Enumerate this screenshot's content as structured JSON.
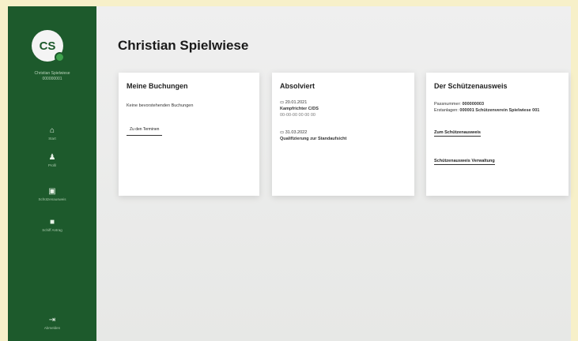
{
  "sidebar": {
    "avatar_initials": "CS",
    "user_name": "Christian Spielwiese\n000000001",
    "items": [
      {
        "label": "Start",
        "icon": "home-icon"
      },
      {
        "label": "Profil",
        "icon": "user-icon"
      },
      {
        "label": "Schützenausweis",
        "icon": "id-card-icon"
      },
      {
        "label": "Schiff Antrag",
        "icon": "document-icon"
      }
    ],
    "logout_label": "Abmelden",
    "logout_icon": "logout-icon"
  },
  "page": {
    "title": "Christian Spielwiese"
  },
  "cards": {
    "bookings": {
      "title": "Meine Buchungen",
      "empty_text": "Keine bevorstehenden Buchungen",
      "button_label": "Zu den Terminen"
    },
    "completed": {
      "title": "Absolviert",
      "entries": [
        {
          "date": "20.01.2021",
          "name": "Kampfrichter C/DS",
          "detail": "00-00-00 00 00 00"
        },
        {
          "date": "31.03.2022",
          "name": "Qualifizierung zur Standaufsicht",
          "detail": ""
        }
      ]
    },
    "id_card": {
      "title": "Der Schützenausweis",
      "pass_label": "Passnummer:",
      "pass_value": "000000003",
      "holder_label": "Erstanlagen:",
      "holder_value": "000001 Schützenverein Spielwiese 001",
      "link1": "Zum Schützenausweis",
      "link2": "Schützenausweis Verwaltung"
    }
  }
}
